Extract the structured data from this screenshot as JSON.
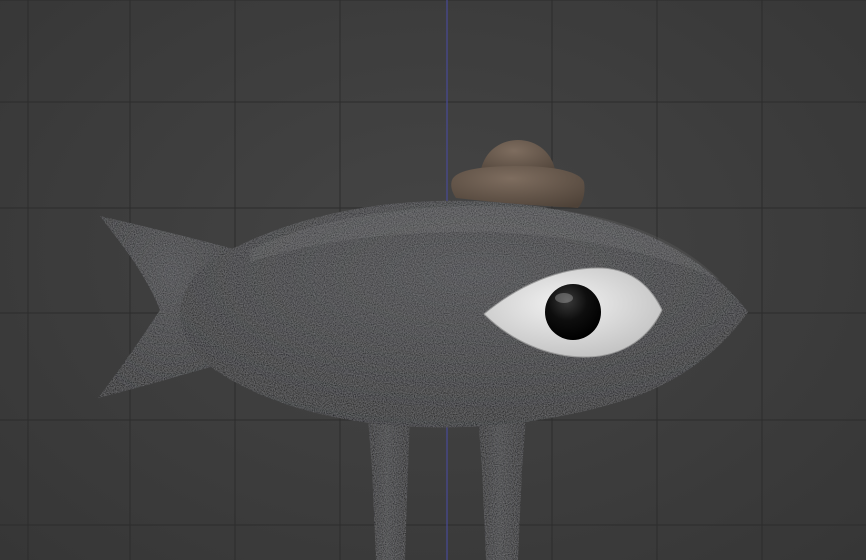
{
  "viewport": {
    "background_color": "#3d3d3d",
    "grid_minor_color": "#333333",
    "grid_major_color": "#2c2c2c",
    "z_axis_color": "#4d4fa8"
  },
  "model": {
    "parts": [
      "fish-body",
      "fish-tail",
      "fish-eye",
      "fish-pupil",
      "fish-hat",
      "fish-leg-left",
      "fish-leg-right"
    ],
    "body_color": "#262729",
    "eye_white_color": "#e4e4e4",
    "pupil_color": "#0c0c0c",
    "hat_color": "#6a5a4d"
  }
}
